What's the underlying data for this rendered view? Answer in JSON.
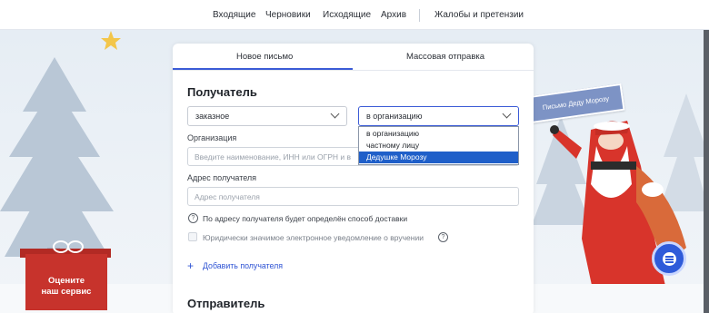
{
  "nav": {
    "items": [
      "Входящие",
      "Черновики",
      "Исходящие",
      "Архив"
    ],
    "complaints": "Жалобы и претензии"
  },
  "tabs": {
    "new_letter": "Новое письмо",
    "bulk_send": "Массовая отправка"
  },
  "recipient": {
    "title": "Получатель",
    "letter_type": "заказное",
    "recipient_type": "в организацию",
    "organization_label": "Организация",
    "organization_placeholder": "Введите наименование, ИНН или ОГРН и в",
    "address_label": "Адрес получателя",
    "address_placeholder": "Адрес получателя",
    "hint": "По адресу получателя будет определён способ доставки",
    "legal_notice": "Юридически значимое электронное уведомление о вручении",
    "add_recipient": "Добавить получателя"
  },
  "dropdown": {
    "options": [
      "в организацию",
      "частному лицу",
      "Дедушке Морозу"
    ],
    "highlighted": "Дедушке Морозу"
  },
  "sender": {
    "title": "Отправитель"
  },
  "decor": {
    "sign_text": "Письмо Деду Морозу",
    "rate_line1": "Оцените",
    "rate_line2": "наш сервис"
  },
  "icons": {
    "help": "question-circle-icon",
    "chat": "chat-icon",
    "chevron": "chevron-down-icon"
  },
  "colors": {
    "accent": "#3b5bd6",
    "link": "#2f54d4",
    "dropdown_selected": "#1f5fc9",
    "gift_red": "#c7332c"
  }
}
